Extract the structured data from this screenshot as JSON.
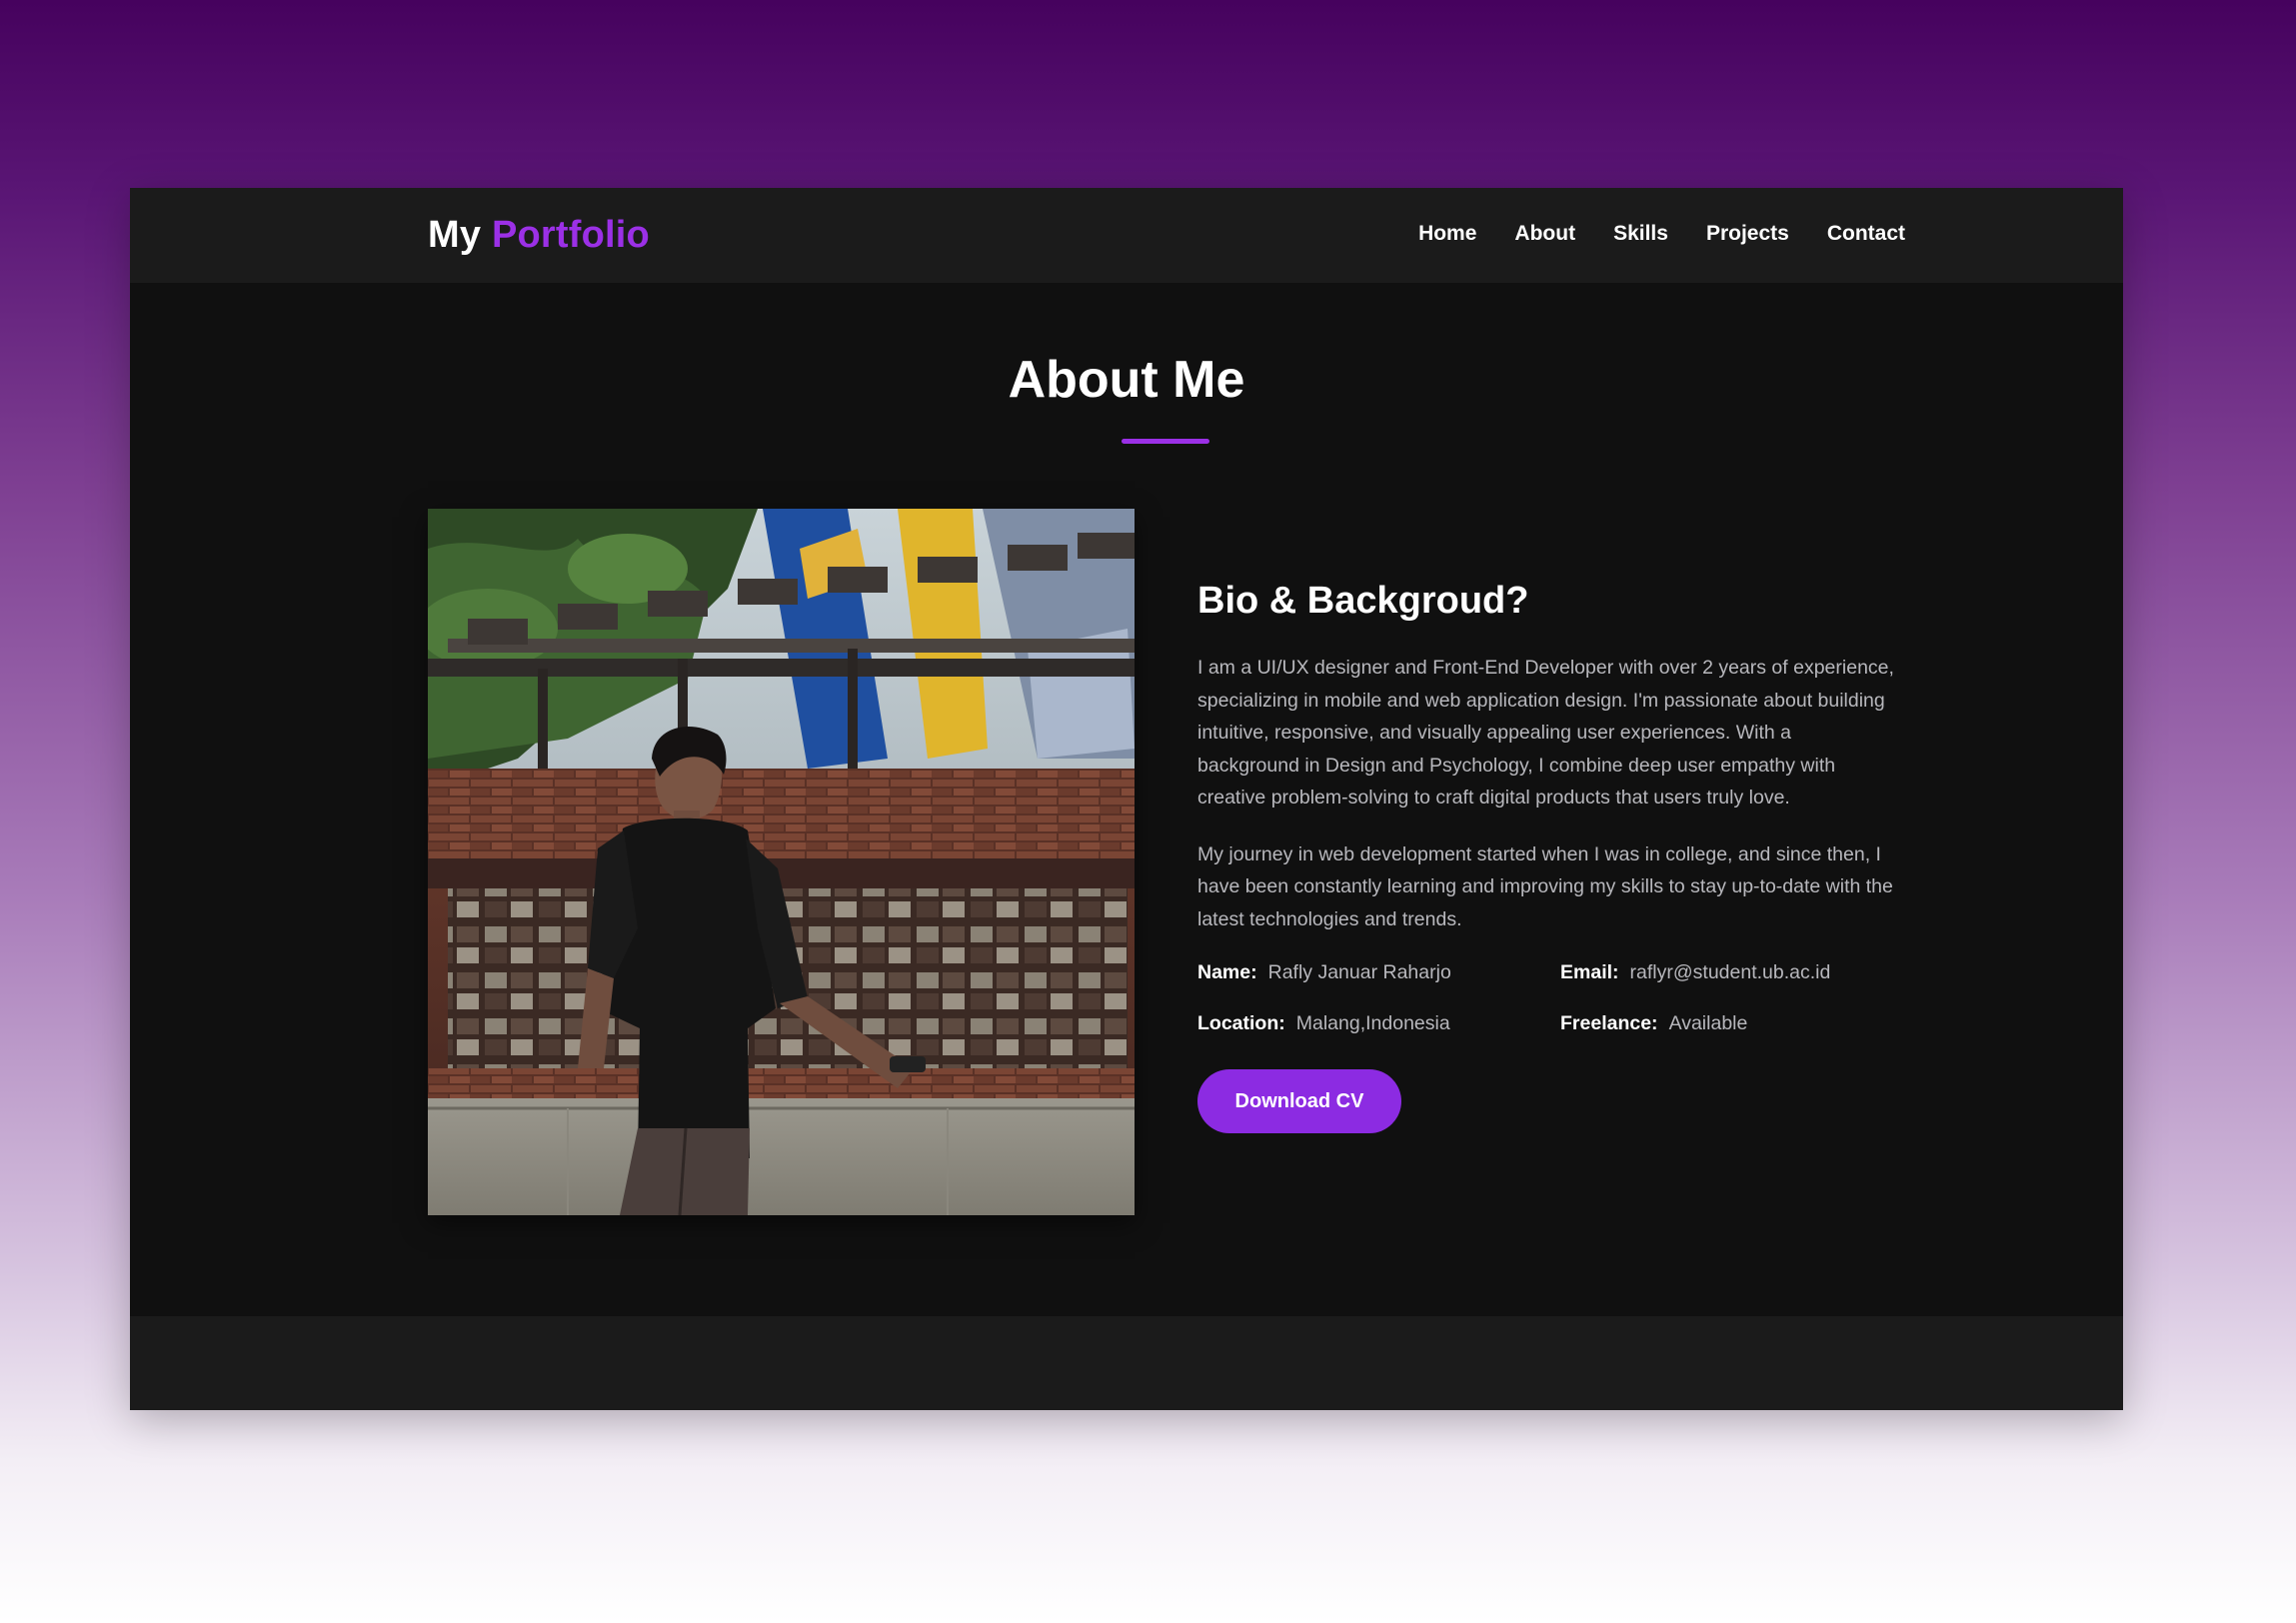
{
  "navbar": {
    "logo_part1": "My ",
    "logo_part2": "Portfolio",
    "links": [
      "Home",
      "About",
      "Skills",
      "Projects",
      "Contact"
    ]
  },
  "about": {
    "title": "About Me",
    "heading": "Bio & Backgroud?",
    "paragraphs": [
      "I am a UI/UX designer and Front-End Developer with over 2 years of experience, specializing in mobile and web application design. I'm passionate about building intuitive, responsive, and visually appealing user experiences. With a background in Design and Psychology, I combine deep user empathy with creative problem-solving to craft digital products that users truly love.",
      "My journey in web development started when I was in college, and since then, I have been constantly learning and improving my skills to stay up-to-date with the latest technologies and trends."
    ],
    "info": {
      "name_label": "Name:",
      "name_value": "Rafly Januar Raharjo",
      "email_label": "Email:",
      "email_value": "raflyr@student.ub.ac.id",
      "location_label": "Location:",
      "location_value": "Malang,Indonesia",
      "freelance_label": "Freelance:",
      "freelance_value": "Available"
    },
    "cta_label": "Download CV"
  },
  "colors": {
    "accent": "#9b30e6",
    "button": "#8c2be2",
    "navbar_bg": "#1b1b1b",
    "section_bg": "#101010"
  }
}
